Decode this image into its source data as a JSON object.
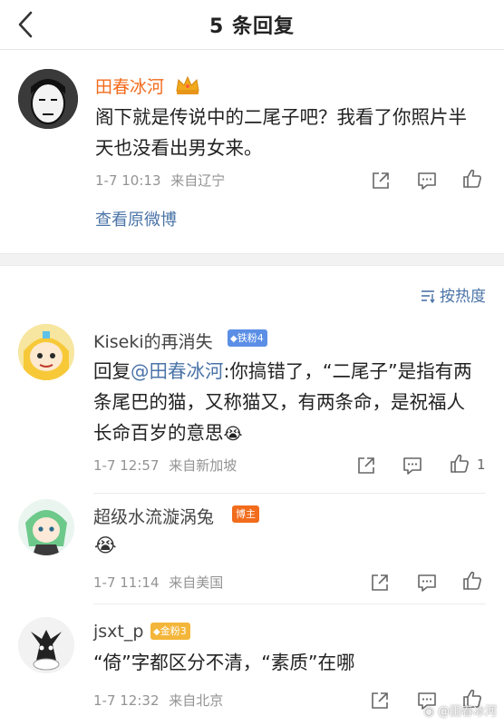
{
  "header": {
    "title": "5 条回复"
  },
  "main_comment": {
    "user": "田春冰河",
    "text": "阁下就是传说中的二尾子吧？我看了你照片半天也没看出男女来。",
    "time": "1-7 10:13",
    "source": "来自辽宁",
    "view_original": "查看原微博"
  },
  "sort": {
    "label": "按热度"
  },
  "replies": [
    {
      "user": "Kiseki的再消失",
      "badge": "铁粉4",
      "reply_prefix": "回复",
      "mention": "@田春冰河",
      "text": ":你搞错了，“二尾子”是指有两条尾巴的猫，又称猫又，有两条命，是祝福人长命百岁的意思",
      "emoji": "😭",
      "time": "1-7 12:57",
      "source": "来自新加坡",
      "likes": "1"
    },
    {
      "user": "超级水流漩涡兔",
      "badge": "博主",
      "emoji": "😭",
      "time": "1-7 11:14",
      "source": "来自美国"
    },
    {
      "user": "jsxt_p",
      "badge": "金粉3",
      "text": "“倚”字都区分不清，“素质”在哪",
      "time": "1-7 12:32",
      "source": "来自北京"
    }
  ],
  "watermark": "@田春冰河",
  "colors": {
    "link": "#4b74a8",
    "username_highlight": "#f26b1d",
    "meta": "#939393"
  }
}
